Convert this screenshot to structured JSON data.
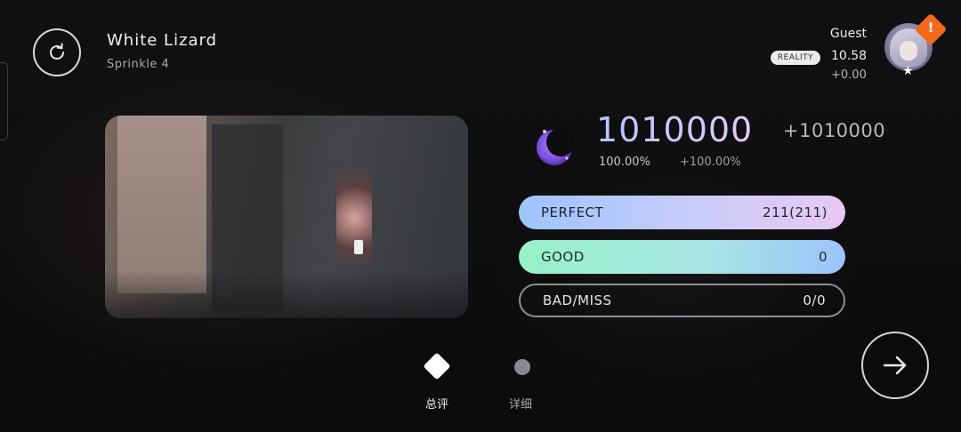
{
  "song": {
    "title": "White Lizard",
    "difficulty": "Sprinkle 4"
  },
  "player": {
    "name": "Guest",
    "tag": "REALITY",
    "rks": "10.58",
    "rks_delta": "+0.00",
    "notification": "!"
  },
  "result": {
    "score": "1010000",
    "score_delta": "+1010000",
    "accuracy": "100.00%",
    "accuracy_delta": "+100.00%"
  },
  "judgements": [
    {
      "label": "PERFECT",
      "value": "211(211)"
    },
    {
      "label": "GOOD",
      "value": "0"
    },
    {
      "label": "BAD/MISS",
      "value": "0/0"
    }
  ],
  "pages": [
    {
      "label": "总评",
      "active": true
    },
    {
      "label": "详细",
      "active": false
    }
  ],
  "icons": {
    "retry": "retry-icon",
    "next": "arrow-right-icon",
    "rank": "moon-rank-icon",
    "avatar": "avatar",
    "badge": "notification-badge-icon",
    "star": "star-icon"
  },
  "colors": {
    "perfect_start": "#9ec3ff",
    "perfect_end": "#e8c8f3",
    "good_start": "#96f2c7",
    "good_end": "#9bc3fb",
    "badge": "#f26a1b",
    "rank_purple": "#8a5cf0"
  }
}
